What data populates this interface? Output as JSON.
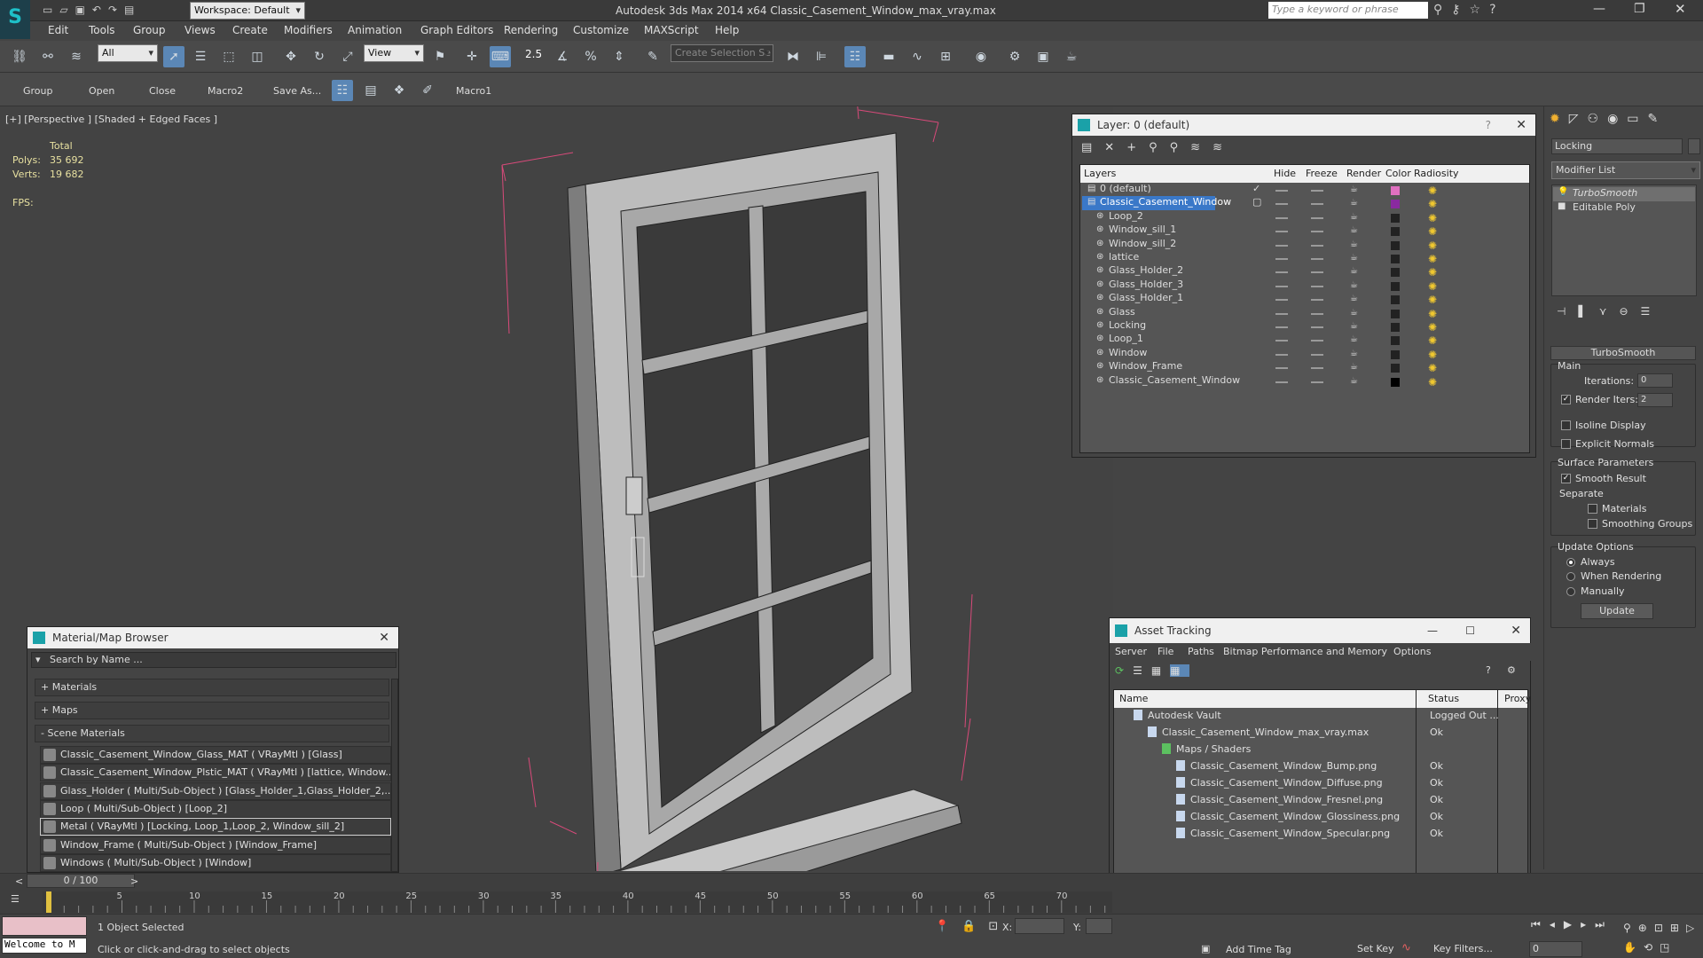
{
  "titlebar": {
    "workspace": "Workspace: Default",
    "app_title": "Autodesk 3ds Max  2014 x64    Classic_Casement_Window_max_vray.max",
    "search_placeholder": "Type a keyword or phrase"
  },
  "menu": [
    "Edit",
    "Tools",
    "Group",
    "Views",
    "Create",
    "Modifiers",
    "Animation",
    "Graph Editors",
    "Rendering",
    "Customize",
    "MAXScript",
    "Help"
  ],
  "toolbar": {
    "filter_value": "All",
    "ref_coord_value": "View",
    "angle_snap": "2.5",
    "selection_set_placeholder": "Create Selection Se"
  },
  "toolbar2": [
    "Group",
    "Open",
    "Close",
    "Macro2",
    "Save As...",
    "Macro1"
  ],
  "viewport": {
    "label": "[+] [Perspective ] [Shaded + Edged Faces ]",
    "stats_header": "Total",
    "polys_label": "Polys:",
    "polys_value": "35 692",
    "verts_label": "Verts:",
    "verts_value": "19 682",
    "fps_label": "FPS:"
  },
  "layer_window": {
    "title": "Layer: 0 (default)",
    "columns": [
      "Layers",
      "Hide",
      "Freeze",
      "Render",
      "Color",
      "Radiosity"
    ],
    "rows": [
      {
        "name": "0 (default)",
        "color": "#e070c0"
      },
      {
        "name": "Classic_Casement_Window",
        "color": "#8a2aa0",
        "selected": true
      },
      {
        "name": "Loop_2",
        "color": "#222222"
      },
      {
        "name": "Window_sill_1",
        "color": "#222222"
      },
      {
        "name": "Window_sill_2",
        "color": "#222222"
      },
      {
        "name": "lattice",
        "color": "#222222"
      },
      {
        "name": "Glass_Holder_2",
        "color": "#222222"
      },
      {
        "name": "Glass_Holder_3",
        "color": "#222222"
      },
      {
        "name": "Glass_Holder_1",
        "color": "#222222"
      },
      {
        "name": "Glass",
        "color": "#222222"
      },
      {
        "name": "Locking",
        "color": "#222222"
      },
      {
        "name": "Loop_1",
        "color": "#222222"
      },
      {
        "name": "Window",
        "color": "#222222"
      },
      {
        "name": "Window_Frame",
        "color": "#222222"
      },
      {
        "name": "Classic_Casement_Window",
        "color": "#000000"
      }
    ]
  },
  "material_browser": {
    "title": "Material/Map Browser",
    "search_placeholder": "Search by Name ...",
    "cat_materials": "+ Materials",
    "cat_maps": "+ Maps",
    "cat_scene": "- Scene Materials",
    "items": [
      "Classic_Casement_Window_Glass_MAT ( VRayMtl ) [Glass]",
      "Classic_Casement_Window_Plstic_MAT ( VRayMtl ) [lattice, Window...",
      "Glass_Holder ( Multi/Sub-Object ) [Glass_Holder_1,Glass_Holder_2,...",
      "Loop ( Multi/Sub-Object ) [Loop_2]",
      "Metal ( VRayMtl ) [Locking, Loop_1,Loop_2, Window_sill_2]",
      "Window_Frame ( Multi/Sub-Object ) [Window_Frame]",
      "Windows ( Multi/Sub-Object ) [Window]"
    ]
  },
  "asset_tracking": {
    "title": "Asset Tracking",
    "menu": [
      "Server",
      "File",
      "Paths",
      "Bitmap Performance and Memory",
      "Options"
    ],
    "columns": [
      "Name",
      "Status",
      "Proxy"
    ],
    "rows": [
      {
        "name": "Autodesk Vault",
        "status": "Logged Out ...",
        "indent": 1
      },
      {
        "name": "Classic_Casement_Window_max_vray.max",
        "status": "Ok",
        "indent": 2
      },
      {
        "name": "Maps / Shaders",
        "status": "",
        "indent": 3
      },
      {
        "name": "Classic_Casement_Window_Bump.png",
        "status": "Ok",
        "indent": 4
      },
      {
        "name": "Classic_Casement_Window_Diffuse.png",
        "status": "Ok",
        "indent": 4
      },
      {
        "name": "Classic_Casement_Window_Fresnel.png",
        "status": "Ok",
        "indent": 4
      },
      {
        "name": "Classic_Casement_Window_Glossiness.png",
        "status": "Ok",
        "indent": 4
      },
      {
        "name": "Classic_Casement_Window_Specular.png",
        "status": "Ok",
        "indent": 4
      }
    ]
  },
  "command_panel": {
    "object_name": "Locking",
    "modifier_list": "Modifier List",
    "stack": [
      "TurboSmooth",
      "Editable Poly"
    ],
    "rollout_title": "TurboSmooth",
    "main_label": "Main",
    "iterations_label": "Iterations:",
    "iterations_value": "0",
    "render_iters_label": "Render Iters:",
    "render_iters_value": "2",
    "isoline": "Isoline Display",
    "explicit": "Explicit Normals",
    "surface_params": "Surface Parameters",
    "smooth_result": "Smooth Result",
    "separate": "Separate",
    "materials": "Materials",
    "smoothing_groups": "Smoothing Groups",
    "update_options": "Update Options",
    "always": "Always",
    "when_rendering": "When Rendering",
    "manually": "Manually",
    "update_btn": "Update"
  },
  "timeline": {
    "frame": "0 / 100",
    "ticks": [
      "5",
      "10",
      "15",
      "20",
      "25",
      "30",
      "35",
      "40",
      "45",
      "50",
      "55",
      "60",
      "65",
      "70"
    ]
  },
  "statusbar": {
    "welcome": "Welcome to M",
    "selected": "1 Object Selected",
    "prompt": "Click or click-and-drag to select objects",
    "x_label": "X:",
    "y_label": "Y:",
    "add_time_tag": "Add Time Tag",
    "set_key": "Set Key",
    "key_filters": "Key Filters...",
    "frame_field": "0"
  },
  "colors": {
    "accent": "#5b87b6",
    "selection": "#3a78c8",
    "grid": "#2a2a2a",
    "bulb": "#f0c830"
  }
}
